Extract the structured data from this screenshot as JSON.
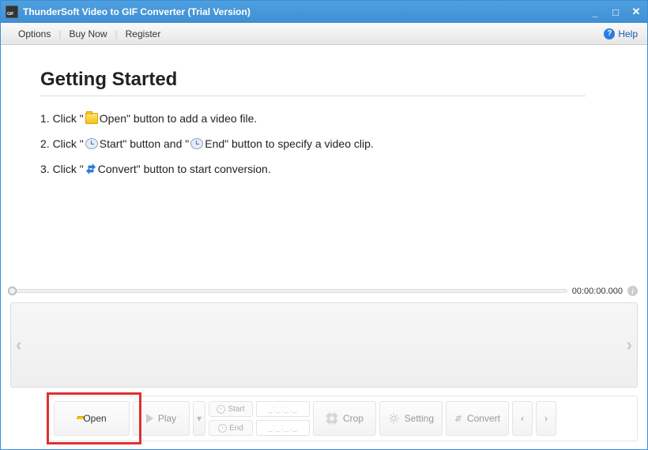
{
  "window": {
    "title": "ThunderSoft Video to GIF Converter (Trial Version)"
  },
  "menubar": {
    "options": "Options",
    "buyNow": "Buy Now",
    "register": "Register",
    "help": "Help"
  },
  "content": {
    "heading": "Getting Started",
    "step1_pre": "1. Click \" ",
    "step1_post": " Open\" button to add a video file.",
    "step2_pre": "2. Click \" ",
    "step2_mid1": " Start\" button and \" ",
    "step2_mid2": " End\" button to specify a video clip.",
    "step3_pre": "3. Click \" ",
    "step3_post": " Convert\" button to start conversion."
  },
  "timeline": {
    "timecode": "00:00:00.000"
  },
  "toolbar": {
    "open": "Open",
    "play": "Play",
    "start": "Start",
    "end": "End",
    "timePlaceholder": "_:_:_._",
    "crop": "Crop",
    "setting": "Setting",
    "convert": "Convert"
  }
}
